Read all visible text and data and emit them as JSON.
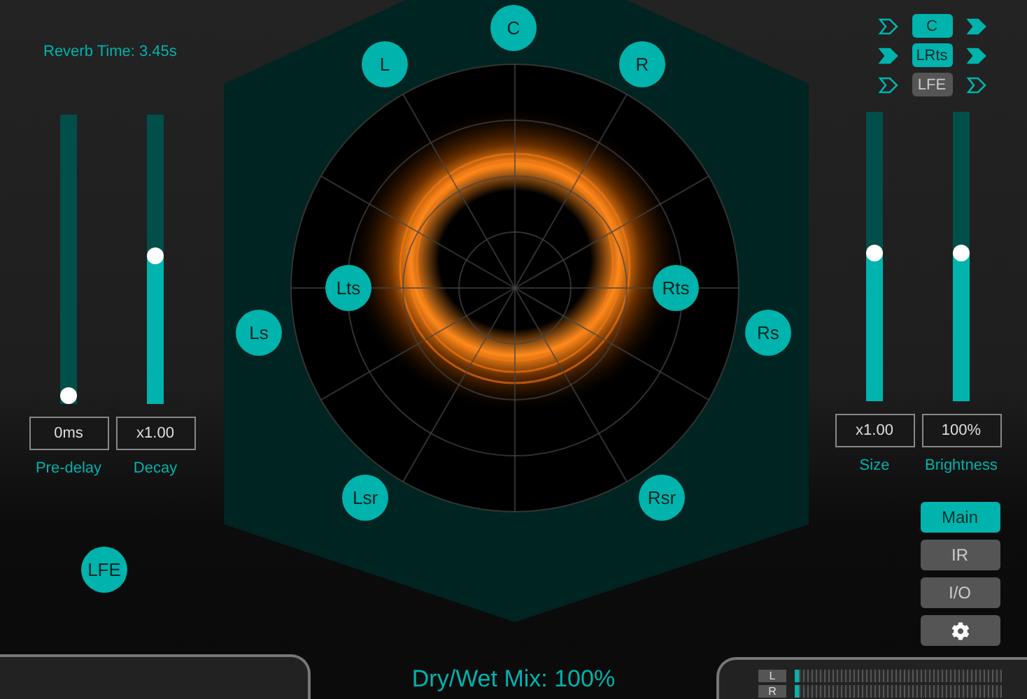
{
  "reverb_time": "Reverb Time: 3.45s",
  "left_sliders": [
    {
      "label": "Pre-delay",
      "value": "0ms",
      "level": 0.0
    },
    {
      "label": "Decay",
      "value": "x1.00",
      "level": 0.51
    }
  ],
  "lfe_button": {
    "label": "LFE"
  },
  "speakers": [
    {
      "label": "C"
    },
    {
      "label": "L"
    },
    {
      "label": "R"
    },
    {
      "label": "Lts"
    },
    {
      "label": "Rts"
    },
    {
      "label": "Ls"
    },
    {
      "label": "Rs"
    },
    {
      "label": "Lsr"
    },
    {
      "label": "Rsr"
    }
  ],
  "crosstalk": [
    {
      "label": "C",
      "active": true,
      "in_on": false,
      "out_on": true
    },
    {
      "label": "LRts",
      "active": true,
      "in_on": true,
      "out_on": true
    },
    {
      "label": "LFE",
      "active": false,
      "in_on": false,
      "out_on": false
    }
  ],
  "right_sliders": [
    {
      "label": "Size",
      "value": "x1.00",
      "level": 0.51
    },
    {
      "label": "Brightness",
      "value": "100%",
      "level": 0.51
    }
  ],
  "nav": [
    {
      "kind": "text",
      "label": "Main",
      "selected": true
    },
    {
      "kind": "text",
      "label": "IR",
      "selected": false
    },
    {
      "kind": "text",
      "label": "I/O",
      "selected": false
    },
    {
      "kind": "gear",
      "selected": false
    }
  ],
  "mix": "Dry/Wet Mix: 100%",
  "meter": [
    {
      "label": "L",
      "level": 0.02
    },
    {
      "label": "R",
      "level": 0.02
    }
  ]
}
